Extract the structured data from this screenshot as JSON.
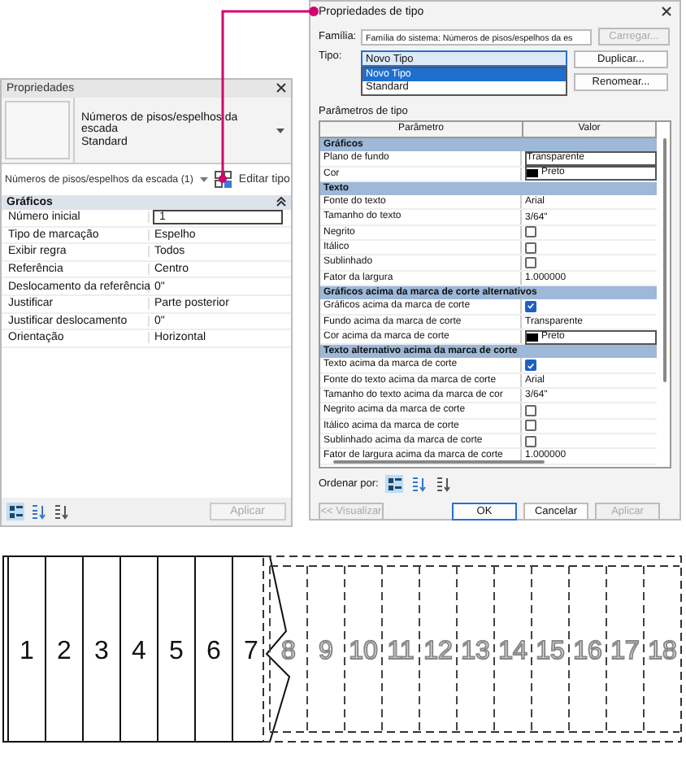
{
  "properties_panel": {
    "title": "Propriedades",
    "type_name": "Números de pisos/espelhos da escada",
    "type_variant": "Standard",
    "selector": "Números de pisos/espelhos da escada (1)",
    "edit_type": "Editar tipo",
    "group": "Gráficos",
    "rows": [
      {
        "name": "Número inicial",
        "value": "1",
        "kind": "field"
      },
      {
        "name": "Tipo de marcação",
        "value": "Espelho",
        "kind": "text"
      },
      {
        "name": "Exibir regra",
        "value": "Todos",
        "kind": "text"
      },
      {
        "name": "Referência",
        "value": "Centro",
        "kind": "text"
      },
      {
        "name": "Deslocamento da referência",
        "value": "0\"",
        "kind": "text"
      },
      {
        "name": "Justificar",
        "value": "Parte posterior",
        "kind": "text"
      },
      {
        "name": "Justificar deslocamento",
        "value": "0\"",
        "kind": "text"
      },
      {
        "name": "Orientação",
        "value": "Horizontal",
        "kind": "text"
      }
    ],
    "sort_modes": [
      {
        "selected": true
      },
      {
        "selected": false
      },
      {
        "selected": false
      }
    ],
    "apply": "Aplicar"
  },
  "dialog": {
    "title": "Propriedades de tipo",
    "family_label": "Família:",
    "family": "Família do sistema: Números de pisos/espelhos da es",
    "load": "Carregar...",
    "type_label": "Tipo:",
    "type": "Novo Tipo",
    "type_options": [
      {
        "label": "Novo Tipo",
        "selected": true
      },
      {
        "label": "Standard",
        "selected": false
      }
    ],
    "duplicate": "Duplicar...",
    "rename": "Renomear...",
    "params_label": "Parâmetros de tipo",
    "columns": [
      "Parâmetro",
      "Valor"
    ],
    "groups": [
      {
        "name": "Gráficos",
        "rows": [
          {
            "kind": "field",
            "name": "Plano de fundo",
            "value": "Transparente"
          },
          {
            "kind": "color",
            "name": "Cor",
            "value": "Preto"
          }
        ]
      },
      {
        "name": "Texto",
        "rows": [
          {
            "kind": "text",
            "name": "Fonte do texto",
            "value": "Arial"
          },
          {
            "kind": "text",
            "name": "Tamanho do texto",
            "value": "3/64\""
          },
          {
            "kind": "check",
            "name": "Negrito",
            "checked": false
          },
          {
            "kind": "check",
            "name": "Itálico",
            "checked": false
          },
          {
            "kind": "check",
            "name": "Sublinhado",
            "checked": false
          },
          {
            "kind": "text",
            "name": "Fator da largura",
            "value": "1.000000"
          }
        ]
      },
      {
        "name": "Gráficos acima da marca de corte alternativos",
        "rows": [
          {
            "kind": "check",
            "name": "Gráficos acima da marca de corte",
            "checked": true
          },
          {
            "kind": "text",
            "name": "Fundo acima da marca de corte",
            "value": "Transparente"
          },
          {
            "kind": "color",
            "name": "Cor acima da marca de corte",
            "value": "Preto"
          }
        ]
      },
      {
        "name": "Texto alternativo acima da marca de corte",
        "rows": [
          {
            "kind": "check",
            "name": "Texto acima da marca de corte",
            "checked": true
          },
          {
            "kind": "text",
            "name": "Fonte do texto acima da marca de corte",
            "value": "Arial"
          },
          {
            "kind": "text",
            "name": "Tamanho do texto acima da marca de cor",
            "value": "3/64\""
          },
          {
            "kind": "check",
            "name": "Negrito acima da marca de corte",
            "checked": false
          },
          {
            "kind": "check",
            "name": "Itálico acima da marca de corte",
            "checked": false
          },
          {
            "kind": "check",
            "name": "Sublinhado acima da marca de corte",
            "checked": false
          },
          {
            "kind": "text",
            "name": "Fator de largura acima da marca de corte",
            "value": "1.000000"
          }
        ]
      }
    ],
    "sort_label": "Ordenar por:",
    "sort_modes": [
      {
        "selected": true
      },
      {
        "selected": false
      },
      {
        "selected": false
      }
    ],
    "buttons": [
      {
        "label": "<< Visualizar",
        "disabled": true,
        "default": false
      },
      {
        "label": "OK",
        "disabled": false,
        "default": true
      },
      {
        "label": "Cancelar",
        "disabled": false,
        "default": false
      },
      {
        "label": "Aplicar",
        "disabled": true,
        "default": false
      }
    ]
  },
  "stair": {
    "treads": [
      {
        "number": "1",
        "hidden": false
      },
      {
        "number": "2",
        "hidden": false
      },
      {
        "number": "3",
        "hidden": false
      },
      {
        "number": "4",
        "hidden": false
      },
      {
        "number": "5",
        "hidden": false
      },
      {
        "number": "6",
        "hidden": false
      },
      {
        "number": "7",
        "hidden": false
      },
      {
        "number": "8",
        "hidden": true
      },
      {
        "number": "9",
        "hidden": true
      },
      {
        "number": "10",
        "hidden": true
      },
      {
        "number": "11",
        "hidden": true
      },
      {
        "number": "12",
        "hidden": true
      },
      {
        "number": "13",
        "hidden": true
      },
      {
        "number": "14",
        "hidden": true
      },
      {
        "number": "15",
        "hidden": true
      },
      {
        "number": "16",
        "hidden": true
      },
      {
        "number": "17",
        "hidden": true
      },
      {
        "number": "18",
        "hidden": true
      }
    ]
  }
}
